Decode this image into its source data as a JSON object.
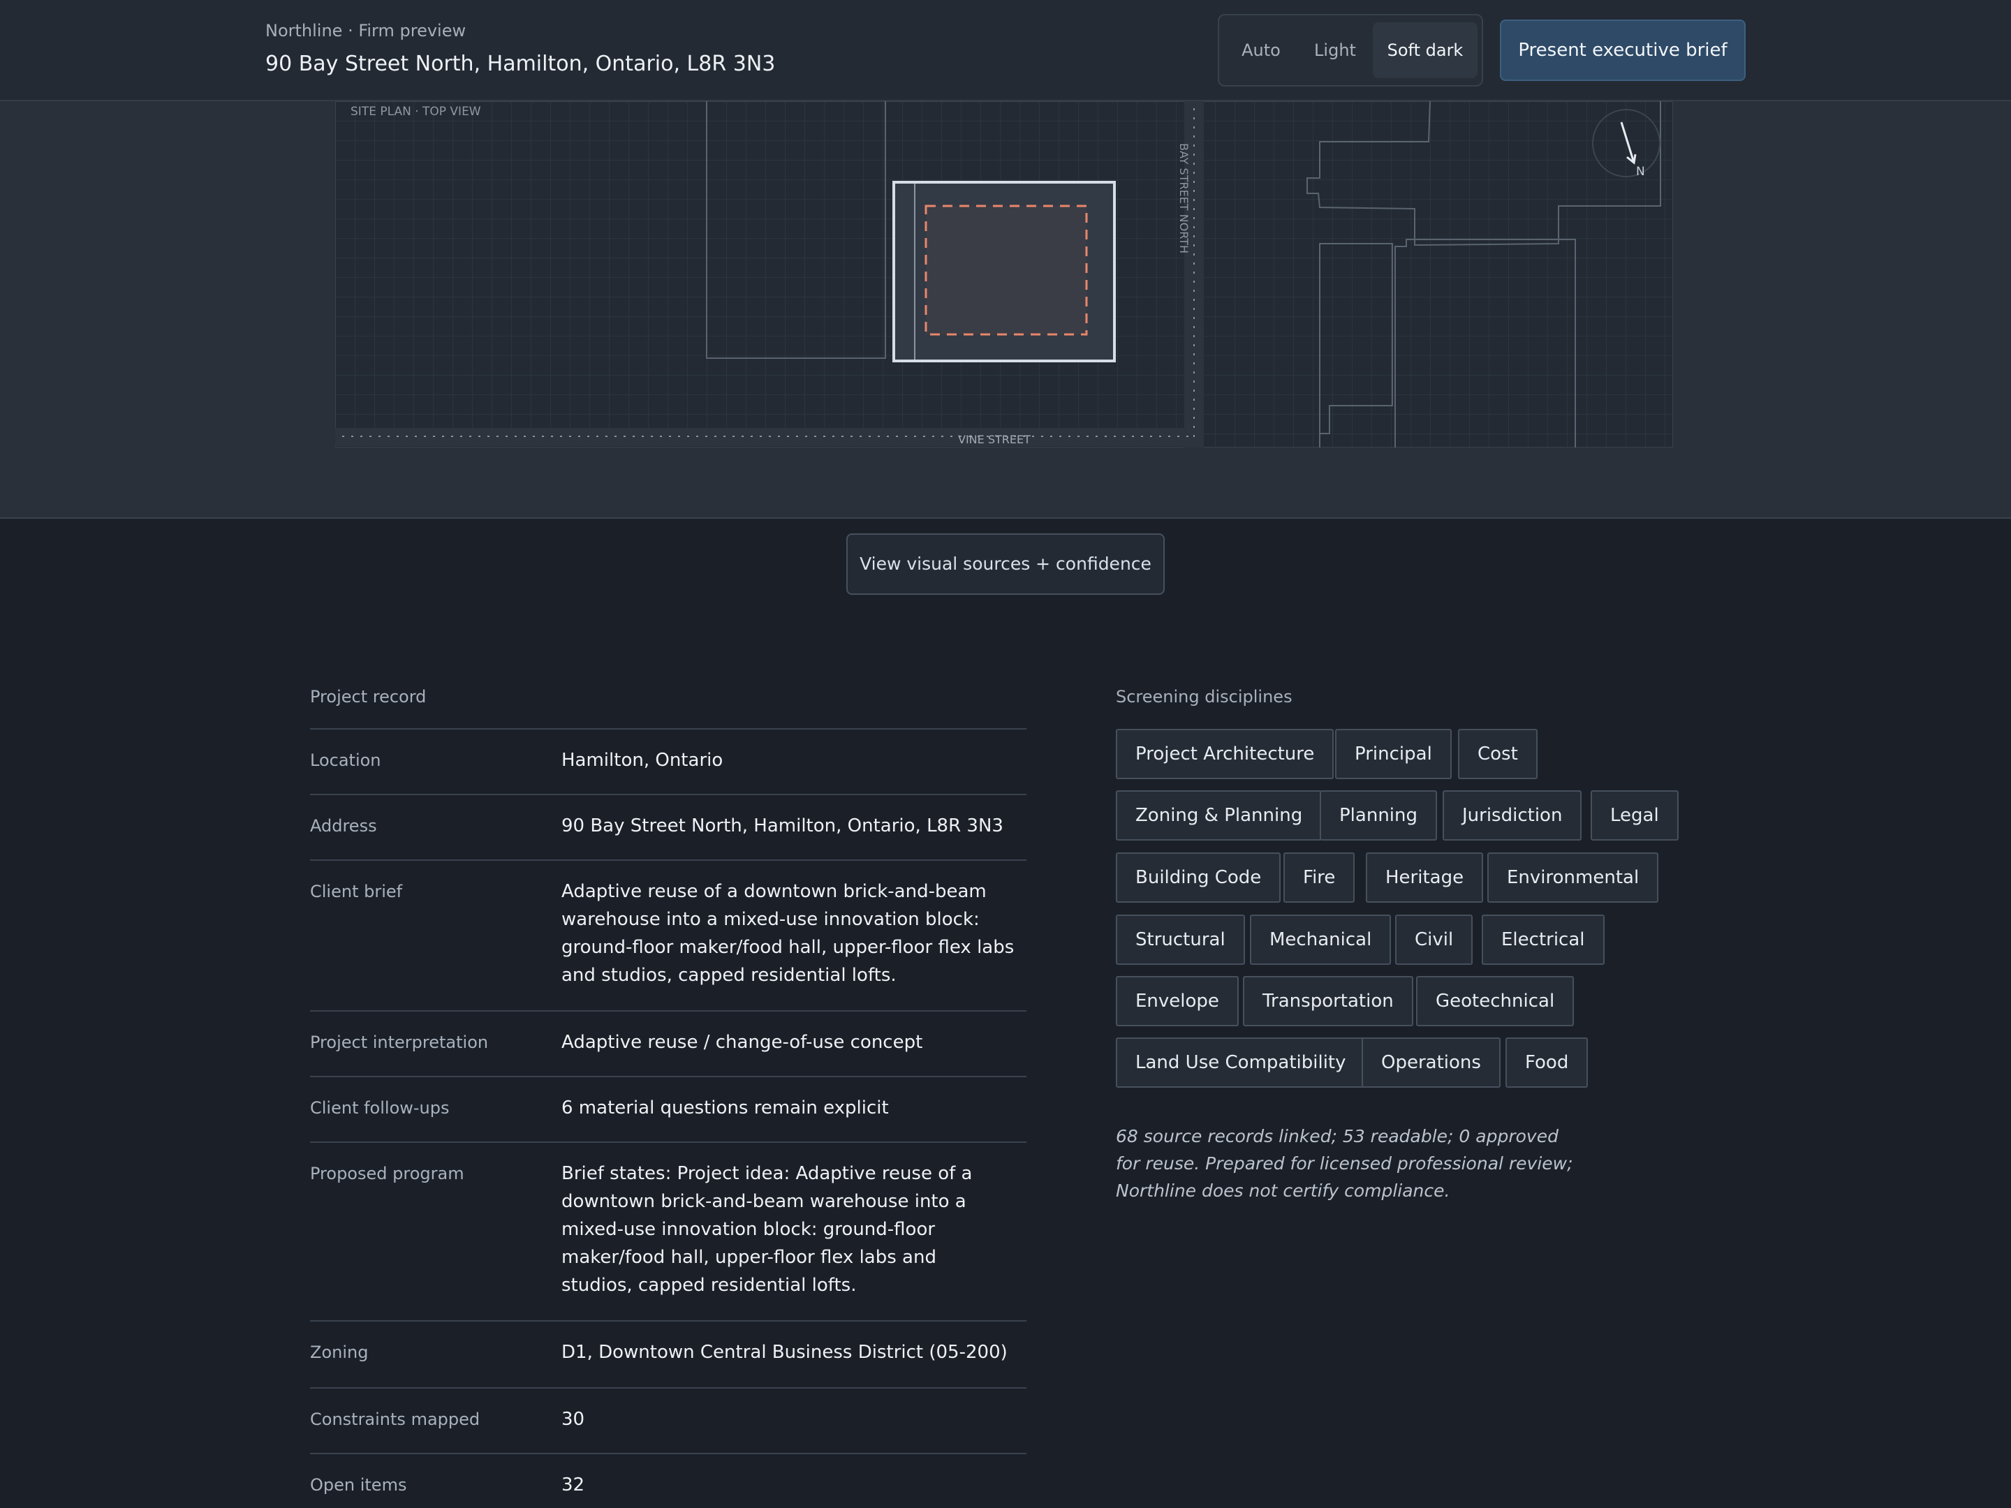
{
  "header": {
    "brand": "Northline · Firm preview",
    "title": "90 Bay Street North, Hamilton, Ontario, L8R 3N3",
    "theme_options": [
      "Auto",
      "Light",
      "Soft dark"
    ],
    "theme_selected": "Soft dark",
    "present_label": "Present executive brief"
  },
  "map": {
    "caption": "SITE PLAN · TOP VIEW",
    "street_vertical": "BAY STREET NORTH",
    "street_horizontal": "VINE STREET",
    "north_label": "N",
    "site_outline_color": "#d6dde6",
    "buildable_color": "#e8876a"
  },
  "sources_button": "View visual sources + confidence",
  "record": {
    "heading": "Project record",
    "rows": [
      {
        "key": "Location",
        "value": "Hamilton, Ontario"
      },
      {
        "key": "Address",
        "value": "90 Bay Street North, Hamilton, Ontario, L8R 3N3"
      },
      {
        "key": "Client brief",
        "value": "Adaptive reuse of a downtown brick-and-beam warehouse into a mixed-use innovation block: ground-floor maker/food hall, upper-floor flex labs and studios, capped residential lofts."
      },
      {
        "key": "Project interpretation",
        "value": "Adaptive reuse / change-of-use concept"
      },
      {
        "key": "Client follow-ups",
        "value": "6 material questions remain explicit"
      },
      {
        "key": "Proposed program",
        "value": "Brief states: Project idea: Adaptive reuse of a downtown brick-and-beam warehouse into a mixed-use innovation block: ground-floor maker/food hall, upper-floor flex labs and studios, capped residential lofts."
      },
      {
        "key": "Zoning",
        "value": "D1, Downtown Central Business District (05-200)"
      },
      {
        "key": "Constraints mapped",
        "value": "30"
      },
      {
        "key": "Open items",
        "value": "32"
      }
    ]
  },
  "disciplines": {
    "heading": "Screening disciplines",
    "chips": [
      "Project Architecture",
      "Principal",
      "Cost",
      "Zoning & Planning",
      "Planning",
      "Jurisdiction",
      "Legal",
      "Building Code",
      "Fire",
      "Heritage",
      "Environmental",
      "Structural",
      "Mechanical",
      "Civil",
      "Electrical",
      "Envelope",
      "Transportation",
      "Geotechnical",
      "Land Use Compatibility",
      "Operations",
      "Food"
    ],
    "note": "68 source records linked; 53 readable; 0 approved for reuse. Prepared for licensed professional review; Northline does not certify compliance."
  }
}
